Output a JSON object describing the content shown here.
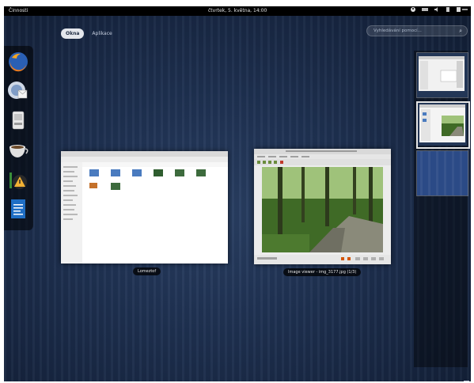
{
  "topbar": {
    "activities": "Činnosti",
    "clock": "čtvrtek, 5. května, 14:00",
    "status_icons": [
      "accessibility-icon",
      "keyboard-icon",
      "volume-icon",
      "battery-icon",
      "user-icon"
    ]
  },
  "tabs": [
    {
      "label": "Okna",
      "active": true
    },
    {
      "label": "Aplikace",
      "active": false
    }
  ],
  "search": {
    "placeholder": "Vyhledávání pomocí..."
  },
  "dash": [
    {
      "name": "firefox-icon"
    },
    {
      "name": "mail-icon"
    },
    {
      "name": "files-icon"
    },
    {
      "name": "cup-icon"
    },
    {
      "name": "software-update-icon"
    },
    {
      "name": "document-icon"
    }
  ],
  "windows": [
    {
      "label": "Lomeztof"
    },
    {
      "label": "Image viewer - img_3177.jpg (1/3)"
    }
  ],
  "colors": {
    "bg": "#1d2f4f",
    "topbar": "#000000",
    "tab_active": "#e4e7ec"
  }
}
